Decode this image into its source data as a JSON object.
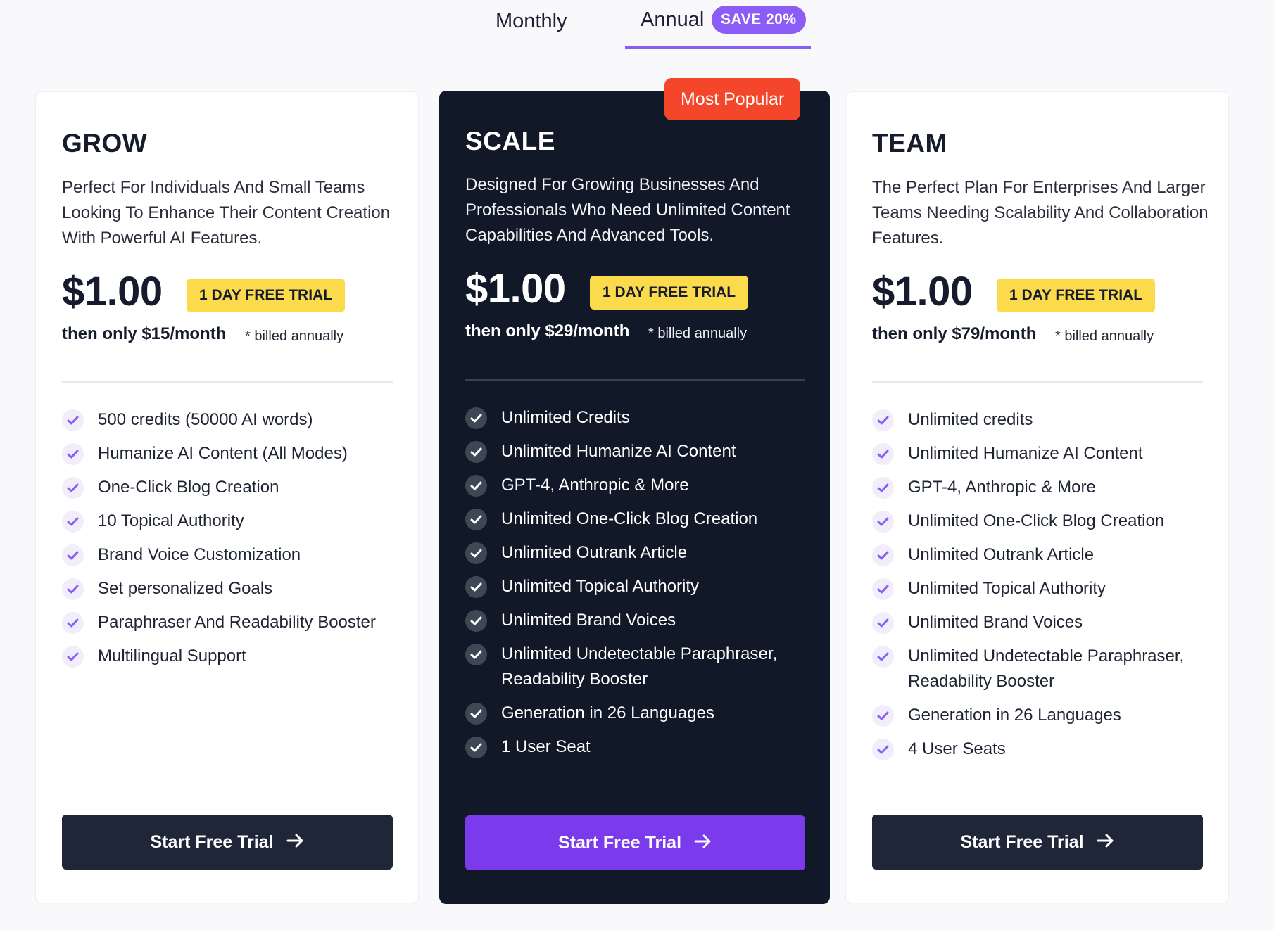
{
  "billing": {
    "monthly_label": "Monthly",
    "annual_label": "Annual",
    "save_badge": "SAVE 20%",
    "active": "Annual"
  },
  "colors": {
    "accent_purple": "#8b5cf6",
    "cta_purple": "#7c3aed",
    "dark_card": "#111827",
    "trial_yellow": "#fbdb4b",
    "popular_red": "#f4462b"
  },
  "plans": [
    {
      "name": "GROW",
      "description": "Perfect For Individuals And Small Teams Looking To Enhance Their Content Creation With Powerful AI Features.",
      "price": "$1.00",
      "trial_badge": "1 DAY FREE TRIAL",
      "then_price": "then only $15/month",
      "billed_note": "* billed annually",
      "features": [
        "500 credits (50000 AI words)",
        "Humanize AI Content (All Modes)",
        "One-Click Blog Creation",
        "10 Topical Authority",
        "Brand Voice Customization",
        "Set personalized Goals",
        "Paraphraser And Readability Booster",
        "Multilingual Support"
      ],
      "cta": "Start Free Trial",
      "icon": "check-icon"
    },
    {
      "name": "SCALE",
      "badge": "Most Popular",
      "description": "Designed For Growing Businesses And Professionals Who Need Unlimited Content Capabilities And Advanced Tools.",
      "price": "$1.00",
      "trial_badge": "1 DAY FREE TRIAL",
      "then_price": "then only $29/month",
      "billed_note": "* billed annually",
      "features": [
        "Unlimited Credits",
        "Unlimited Humanize AI Content",
        "GPT-4, Anthropic & More",
        "Unlimited One-Click Blog Creation",
        "Unlimited Outrank Article",
        "Unlimited Topical Authority",
        "Unlimited Brand Voices",
        "Unlimited Undetectable Paraphraser, Readability Booster",
        "Generation in 26 Languages",
        "1 User Seat"
      ],
      "cta": "Start Free Trial",
      "icon": "check-icon"
    },
    {
      "name": "TEAM",
      "description": "The Perfect Plan For Enterprises And Larger Teams Needing Scalability And Collaboration Features.",
      "price": "$1.00",
      "trial_badge": "1 DAY FREE TRIAL",
      "then_price": "then only $79/month",
      "billed_note": "* billed annually",
      "features": [
        "Unlimited credits",
        "Unlimited Humanize AI Content",
        "GPT-4, Anthropic & More",
        "Unlimited One-Click Blog Creation",
        "Unlimited Outrank Article",
        "Unlimited Topical Authority",
        "Unlimited Brand Voices",
        "Unlimited Undetectable Paraphraser, Readability Booster",
        "Generation in 26 Languages",
        "4 User Seats"
      ],
      "cta": "Start Free Trial",
      "icon": "check-icon"
    }
  ]
}
